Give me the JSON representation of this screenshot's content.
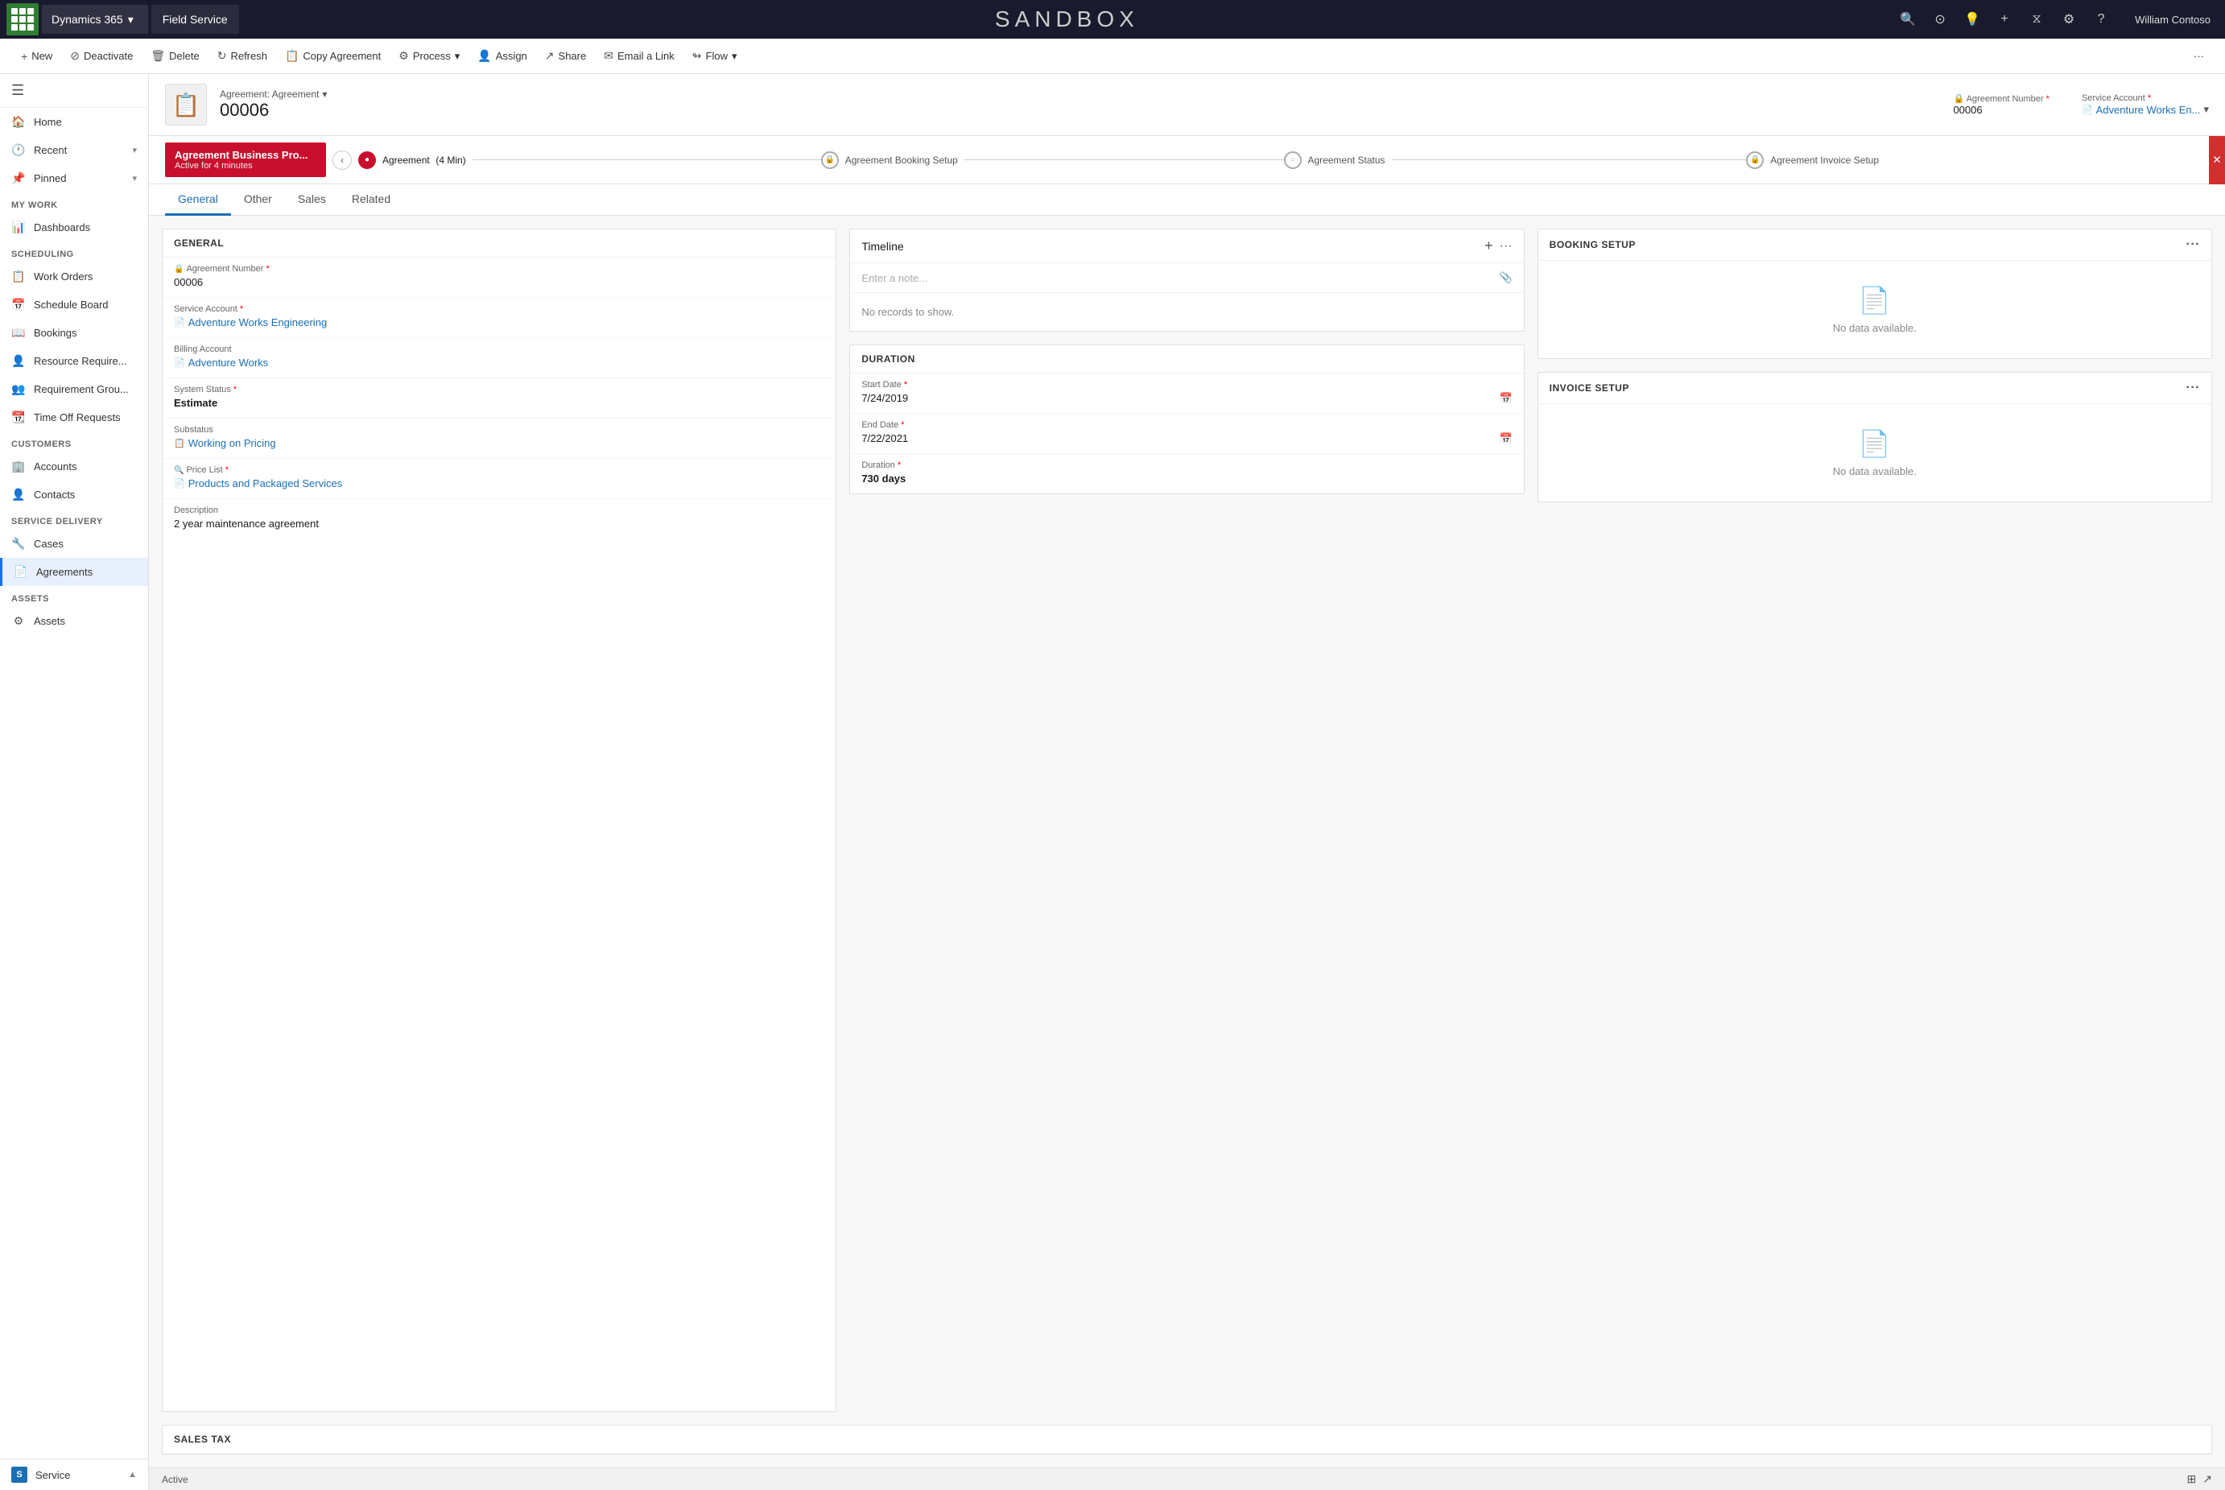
{
  "topnav": {
    "app_name": "Dynamics 365",
    "module_name": "Field Service",
    "sandbox_label": "SANDBOX",
    "user_name": "William Contoso",
    "search_icon": "🔍",
    "recent_icon": "⊙",
    "lightbulb_icon": "💡",
    "plus_icon": "+",
    "filter_icon": "⧖",
    "settings_icon": "⚙",
    "help_icon": "?"
  },
  "breadcrumb": {
    "items": [
      "Service",
      "Agreements",
      "00006"
    ]
  },
  "commandbar": {
    "new_label": "New",
    "deactivate_label": "Deactivate",
    "delete_label": "Delete",
    "refresh_label": "Refresh",
    "copy_label": "Copy Agreement",
    "process_label": "Process",
    "assign_label": "Assign",
    "share_label": "Share",
    "email_link_label": "Email a Link",
    "flow_label": "Flow",
    "more_label": "···"
  },
  "record": {
    "type_label": "Agreement: Agreement",
    "number": "00006",
    "agreement_number_label": "Agreement Number",
    "agreement_number_value": "00006",
    "service_account_label": "Service Account",
    "service_account_value": "Adventure Works En...",
    "dropdown_icon": "▼"
  },
  "process_bar": {
    "stage_title": "Agreement Business Pro...",
    "stage_subtitle": "Active for 4 minutes",
    "steps": [
      {
        "label": "Agreement",
        "sublabel": "(4 Min)",
        "state": "active"
      },
      {
        "label": "Agreement Booking Setup",
        "state": "locked"
      },
      {
        "label": "Agreement Status",
        "state": "locked"
      },
      {
        "label": "Agreement Invoice Setup",
        "state": "locked"
      }
    ]
  },
  "tabs": {
    "items": [
      "General",
      "Other",
      "Sales",
      "Related"
    ],
    "active_index": 0
  },
  "general_section": {
    "title": "GENERAL",
    "fields": [
      {
        "label": "Agreement Number",
        "value": "00006",
        "locked": true,
        "required": true
      },
      {
        "label": "Service Account",
        "value": "Adventure Works Engineering",
        "link": true,
        "required": true
      },
      {
        "label": "Billing Account",
        "value": "Adventure Works",
        "link": true
      },
      {
        "label": "System Status",
        "value": "Estimate",
        "required": true,
        "bold": true
      },
      {
        "label": "Substatus",
        "value": "Working on Pricing",
        "link": true
      },
      {
        "label": "Price List",
        "value": "Products and Packaged Services",
        "link": true,
        "required": true
      },
      {
        "label": "Description",
        "value": "2 year maintenance agreement"
      }
    ]
  },
  "timeline": {
    "title": "Timeline",
    "input_placeholder": "Enter a note...",
    "empty_message": "No records to show."
  },
  "duration_section": {
    "title": "DURATION",
    "fields": [
      {
        "label": "Start Date",
        "value": "7/24/2019",
        "required": true
      },
      {
        "label": "End Date",
        "value": "7/22/2021",
        "required": true
      },
      {
        "label": "Duration",
        "value": "730 days",
        "required": true,
        "bold": true
      }
    ]
  },
  "booking_setup": {
    "title": "BOOKING SETUP",
    "empty_message": "No data available."
  },
  "invoice_setup": {
    "title": "INVOICE SETUP",
    "empty_message": "No data available."
  },
  "sales_tax": {
    "title": "SALES TAX"
  },
  "sidebar": {
    "hamburger": "☰",
    "nav_top": [
      {
        "label": "Home",
        "icon": "🏠"
      },
      {
        "label": "Recent",
        "icon": "🕐",
        "expandable": true
      },
      {
        "label": "Pinned",
        "icon": "📌",
        "expandable": true
      }
    ],
    "my_work_label": "My Work",
    "my_work_items": [
      {
        "label": "Dashboards",
        "icon": "📊"
      }
    ],
    "scheduling_label": "Scheduling",
    "scheduling_items": [
      {
        "label": "Work Orders",
        "icon": "📋"
      },
      {
        "label": "Schedule Board",
        "icon": "📅"
      },
      {
        "label": "Bookings",
        "icon": "📖"
      },
      {
        "label": "Resource Require...",
        "icon": "👤"
      },
      {
        "label": "Requirement Grou...",
        "icon": "👥"
      },
      {
        "label": "Time Off Requests",
        "icon": "📆"
      }
    ],
    "customers_label": "Customers",
    "customers_items": [
      {
        "label": "Accounts",
        "icon": "🏢"
      },
      {
        "label": "Contacts",
        "icon": "👤"
      }
    ],
    "service_delivery_label": "Service Delivery",
    "service_delivery_items": [
      {
        "label": "Cases",
        "icon": "🔧"
      },
      {
        "label": "Agreements",
        "icon": "📄",
        "active": true
      }
    ],
    "assets_label": "Assets",
    "assets_items": [
      {
        "label": "Assets",
        "icon": "⚙"
      }
    ],
    "bottom_item": {
      "label": "Service",
      "icon": "S"
    }
  },
  "status_bar": {
    "status": "Active"
  }
}
